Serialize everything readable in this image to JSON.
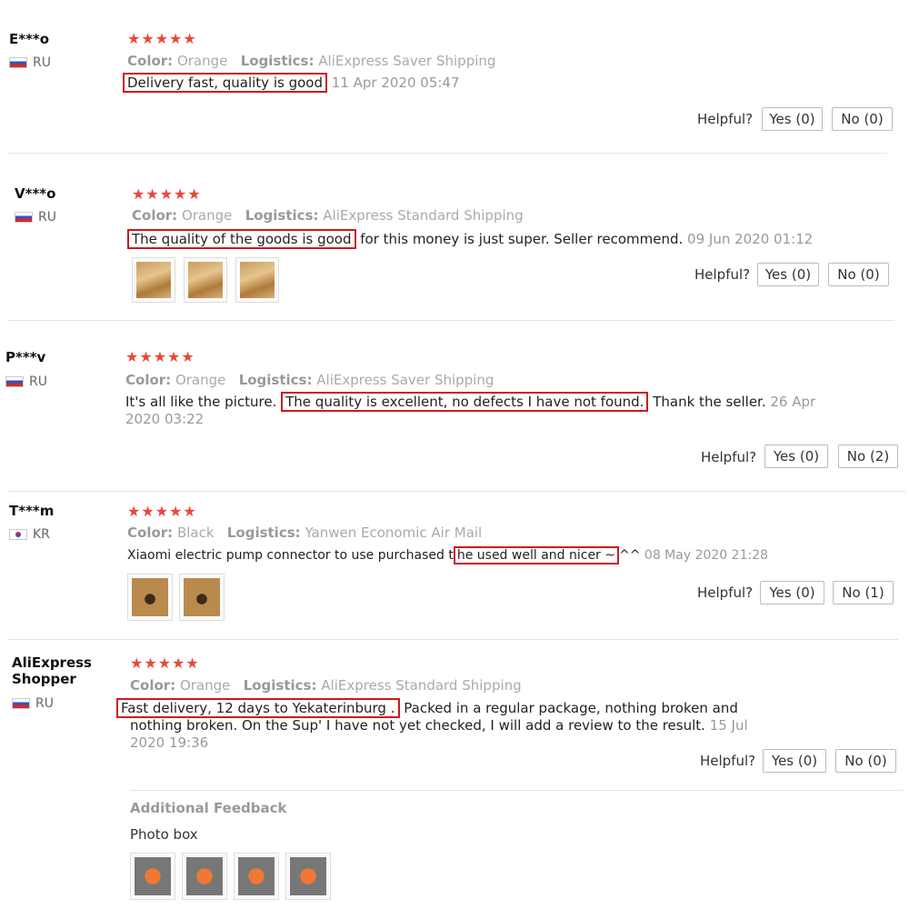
{
  "reviews": [
    {
      "user": "E***o",
      "country": "RU",
      "stars": "★★★★★",
      "color_label": "Color:",
      "color": "Orange",
      "logistics_label": "Logistics:",
      "logistics": "AliExpress Saver Shipping",
      "highlight": "Delivery fast, quality is good",
      "text_after": "",
      "date": "11 Apr 2020 05:47",
      "helpful": "Helpful?",
      "yes": "Yes (0)",
      "no": "No (0)"
    },
    {
      "user": "V***o",
      "country": "RU",
      "stars": "★★★★★",
      "color_label": "Color:",
      "color": "Orange",
      "logistics_label": "Logistics:",
      "logistics": "AliExpress Standard Shipping",
      "highlight": "The quality of the goods is good",
      "text_after": " for this money is just super. Seller recommend.",
      "date": "09 Jun 2020 01:12",
      "helpful": "Helpful?",
      "yes": "Yes (0)",
      "no": "No (0)"
    },
    {
      "user": "P***v",
      "country": "RU",
      "stars": "★★★★★",
      "color_label": "Color:",
      "color": "Orange",
      "logistics_label": "Logistics:",
      "logistics": "AliExpress Saver Shipping",
      "text_before": "It's all like the picture.",
      "highlight": "The quality is excellent, no defects I have not found.",
      "text_after": "Thank the seller.",
      "date": "26 Apr 2020 03:22",
      "helpful": "Helpful?",
      "yes": "Yes (0)",
      "no": "No (2)"
    },
    {
      "user": "T***m",
      "country": "KR",
      "stars": "★★★★★",
      "color_label": "Color:",
      "color": "Black",
      "logistics_label": "Logistics:",
      "logistics": "Yanwen Economic Air Mail",
      "text_before": "Xiaomi electric pump connector to use purchased t",
      "highlight": "he used well and nicer ~",
      "text_after": "^^",
      "date": "08 May 2020 21:28",
      "helpful": "Helpful?",
      "yes": "Yes (0)",
      "no": "No (1)"
    },
    {
      "user": "AliExpress Shopper",
      "country": "RU",
      "stars": "★★★★★",
      "color_label": "Color:",
      "color": "Orange",
      "logistics_label": "Logistics:",
      "logistics": "AliExpress Standard Shipping",
      "highlight": "Fast delivery, 12 days to Yekaterinburg .",
      "text_after": " Packed in a regular package, nothing broken and nothing broken. On the Sup' I have not yet checked, I will add a review to the result.",
      "date": "15 Jul 2020 19:36",
      "helpful": "Helpful?",
      "yes": "Yes (0)",
      "no": "No (0)",
      "additional_feedback": "Additional Feedback",
      "photo_box": "Photo box"
    }
  ]
}
